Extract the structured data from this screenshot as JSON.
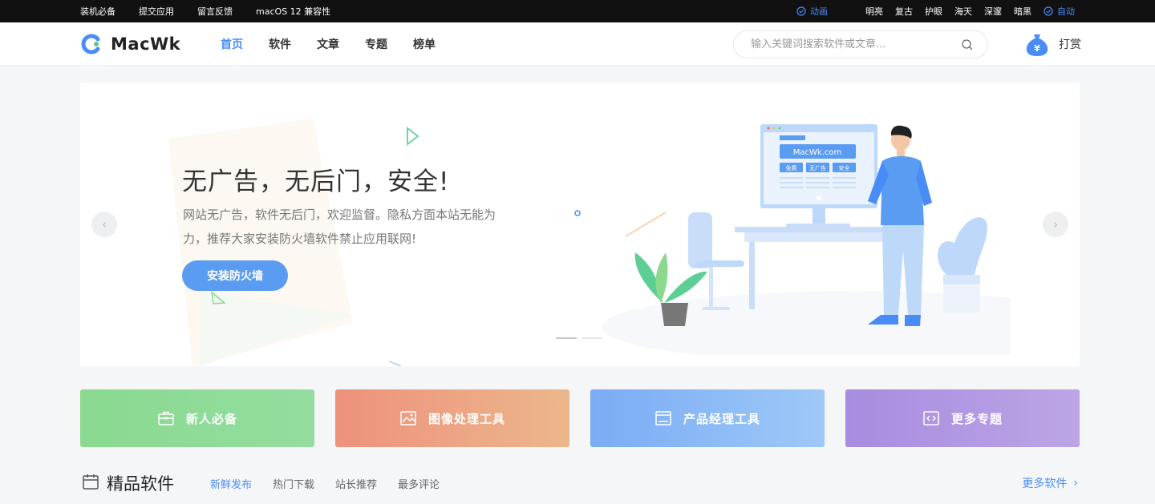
{
  "topbar": {
    "left_links": [
      "装机必备",
      "提交应用",
      "留言反馈",
      "macOS 12 兼容性"
    ],
    "animation_label": "动画",
    "themes": [
      "明亮",
      "复古",
      "护眼",
      "海天",
      "深邃",
      "暗黑"
    ],
    "auto_label": "自动",
    "accent": "#4a8cf7"
  },
  "header": {
    "logo_text": "MacWk",
    "nav": [
      "首页",
      "软件",
      "文章",
      "专题",
      "榜单"
    ],
    "active_nav": "首页",
    "search_placeholder": "输入关键词搜索软件或文章...",
    "reward_label": "打赏"
  },
  "banner": {
    "title": "无广告，无后门，安全!",
    "description": "网站无广告，软件无后门，欢迎监督。隐私方面本站无能为力，推荐大家安装防火墙软件禁止应用联网!",
    "button_label": "安装防火墙",
    "prev_icon": "chevron-left-icon",
    "next_icon": "chevron-right-icon",
    "slides_count": 2,
    "active_slide": 1,
    "screen_site": "MacWk.com",
    "screen_tags": [
      "免费",
      "无广告",
      "安全"
    ]
  },
  "cards": [
    {
      "label": "新人必备",
      "icon": "briefcase-icon",
      "color": "#8ad98f"
    },
    {
      "label": "图像处理工具",
      "icon": "image-icon",
      "color": "#ee917c"
    },
    {
      "label": "产品经理工具",
      "icon": "window-icon",
      "color": "#7aacf5"
    },
    {
      "label": "更多专题",
      "icon": "code-icon",
      "color": "#a78ce0"
    }
  ],
  "section": {
    "title": "精品软件",
    "tabs": [
      "新鲜发布",
      "热门下载",
      "站长推荐",
      "最多评论"
    ],
    "active_tab": "新鲜发布",
    "more_label": "更多软件"
  }
}
